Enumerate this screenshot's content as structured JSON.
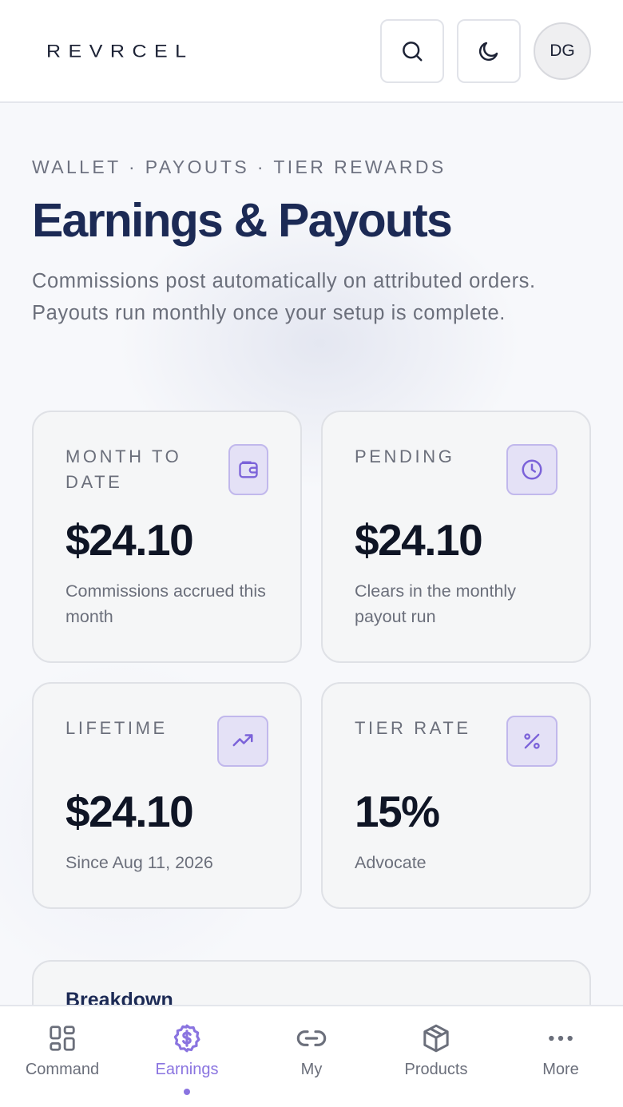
{
  "header": {
    "logo": "REVRCEL",
    "search_icon": "search-icon",
    "theme_icon": "moon-icon",
    "avatar_initials": "DG"
  },
  "hero": {
    "eyebrow": "WALLET · PAYOUTS · TIER REWARDS",
    "title": "Earnings & Payouts",
    "description": "Commissions post automatically on attributed orders. Payouts run monthly once your setup is complete."
  },
  "cards": [
    {
      "label": "MONTH TO DATE",
      "value": "$24.10",
      "note": "Commissions accrued this month",
      "icon": "wallet-icon"
    },
    {
      "label": "PENDING",
      "value": "$24.10",
      "note": "Clears in the monthly payout run",
      "icon": "clock-icon"
    },
    {
      "label": "LIFETIME",
      "value": "$24.10",
      "note": "Since Aug 11, 2026",
      "icon": "trending-up-icon"
    },
    {
      "label": "TIER RATE",
      "value": "15%",
      "note": "Advocate",
      "icon": "percent-icon"
    }
  ],
  "breakdown": {
    "title": "Breakdown"
  },
  "nav": {
    "items": [
      {
        "label": "Command",
        "icon": "grid-icon"
      },
      {
        "label": "Earnings",
        "icon": "dollar-circle-icon",
        "active": true
      },
      {
        "label": "My",
        "icon": "link-icon"
      },
      {
        "label": "Products",
        "icon": "box-icon"
      },
      {
        "label": "More",
        "icon": "more-icon"
      }
    ]
  },
  "colors": {
    "accent": "#8a74e0",
    "title": "#1c2a55",
    "icon_bg": "#e4e1f6"
  }
}
